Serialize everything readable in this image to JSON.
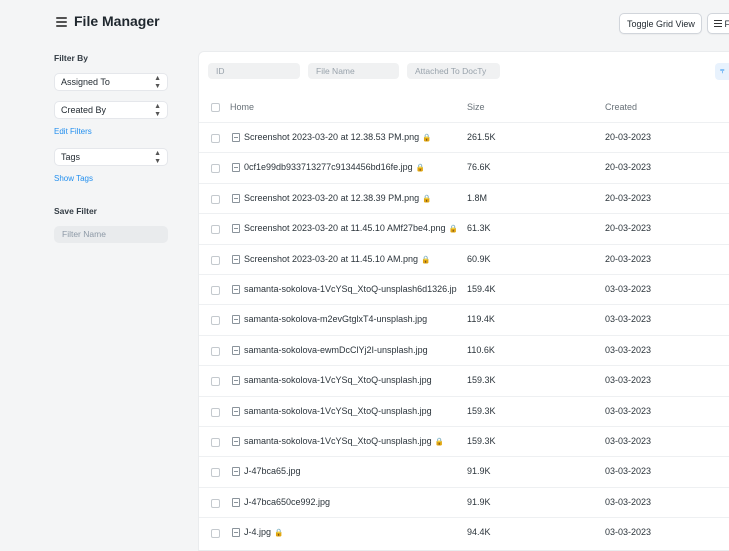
{
  "header": {
    "title": "File Manager",
    "toggle_grid_label": "Toggle Grid View",
    "menu_label": "F"
  },
  "sidebar": {
    "filter_by_label": "Filter By",
    "assigned_to": "Assigned To",
    "created_by": "Created By",
    "edit_filters": "Edit Filters",
    "tags": "Tags",
    "show_tags": "Show Tags",
    "save_filter_label": "Save Filter",
    "filter_name_placeholder": "Filter Name"
  },
  "filters": {
    "id_placeholder": "ID",
    "file_name_placeholder": "File Name",
    "attached_placeholder": "Attached To DocTy"
  },
  "table": {
    "columns": {
      "name": "Home",
      "size": "Size",
      "created": "Created"
    },
    "rows": [
      {
        "name": "Screenshot 2023-03-20 at 12.38.53 PM.png",
        "size": "261.5K",
        "created": "20-03-2023",
        "locked": true
      },
      {
        "name": "0cf1e99db933713277c9134456bd16fe.jpg",
        "size": "76.6K",
        "created": "20-03-2023",
        "locked": true
      },
      {
        "name": "Screenshot 2023-03-20 at 12.38.39 PM.png",
        "size": "1.8M",
        "created": "20-03-2023",
        "locked": true
      },
      {
        "name": "Screenshot 2023-03-20 at 11.45.10 AMf27be4.png",
        "size": "61.3K",
        "created": "20-03-2023",
        "locked": true
      },
      {
        "name": "Screenshot 2023-03-20 at 11.45.10 AM.png",
        "size": "60.9K",
        "created": "20-03-2023",
        "locked": true
      },
      {
        "name": "samanta-sokolova-1VcYSq_XtoQ-unsplash6d1326.jp",
        "size": "159.4K",
        "created": "03-03-2023",
        "locked": false
      },
      {
        "name": "samanta-sokolova-m2evGtglxT4-unsplash.jpg",
        "size": "119.4K",
        "created": "03-03-2023",
        "locked": false
      },
      {
        "name": "samanta-sokolova-ewmDcClYj2I-unsplash.jpg",
        "size": "110.6K",
        "created": "03-03-2023",
        "locked": false
      },
      {
        "name": "samanta-sokolova-1VcYSq_XtoQ-unsplash.jpg",
        "size": "159.3K",
        "created": "03-03-2023",
        "locked": false
      },
      {
        "name": "samanta-sokolova-1VcYSq_XtoQ-unsplash.jpg",
        "size": "159.3K",
        "created": "03-03-2023",
        "locked": false
      },
      {
        "name": "samanta-sokolova-1VcYSq_XtoQ-unsplash.jpg",
        "size": "159.3K",
        "created": "03-03-2023",
        "locked": true
      },
      {
        "name": "J-47bca65.jpg",
        "size": "91.9K",
        "created": "03-03-2023",
        "locked": false
      },
      {
        "name": "J-47bca650ce992.jpg",
        "size": "91.9K",
        "created": "03-03-2023",
        "locked": false
      },
      {
        "name": "J-4.jpg",
        "size": "94.4K",
        "created": "03-03-2023",
        "locked": true
      }
    ]
  },
  "icons": {
    "lock": "lock-icon",
    "file": "file-image-icon",
    "filter": "filter-icon"
  }
}
